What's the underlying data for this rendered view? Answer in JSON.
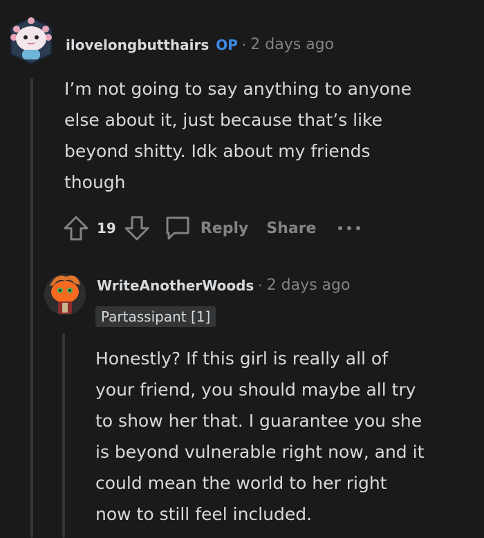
{
  "comment1": {
    "author": "ilovelongbutthairs",
    "op_badge": "OP",
    "separator": "·",
    "time": "2 days ago",
    "body_lines": [
      "I’m not going to say anything to anyone",
      "else about it, just because that’s like",
      "beyond shitty. Idk about my friends",
      "though"
    ],
    "upvote_count": "19",
    "reply_label": "Reply",
    "share_label": "Share",
    "more_icon": "ellipsis-icon"
  },
  "comment2": {
    "author": "WriteAnotherWoods",
    "separator": "·",
    "time": "2 days ago",
    "flair": "Partassipant [1]",
    "body_lines": [
      "Honestly? If this girl is really all of",
      "your friend, you should maybe all try",
      "to show her that. I guarantee you she",
      "is beyond vulnerable right now, and it",
      "could mean the world to her right",
      "now to still feel included."
    ]
  },
  "colors": {
    "background": "#1a1a1b",
    "op_badge": "#3e8ae6",
    "text": "#d7dadc",
    "muted": "#818384",
    "flair_bg": "#343536"
  }
}
